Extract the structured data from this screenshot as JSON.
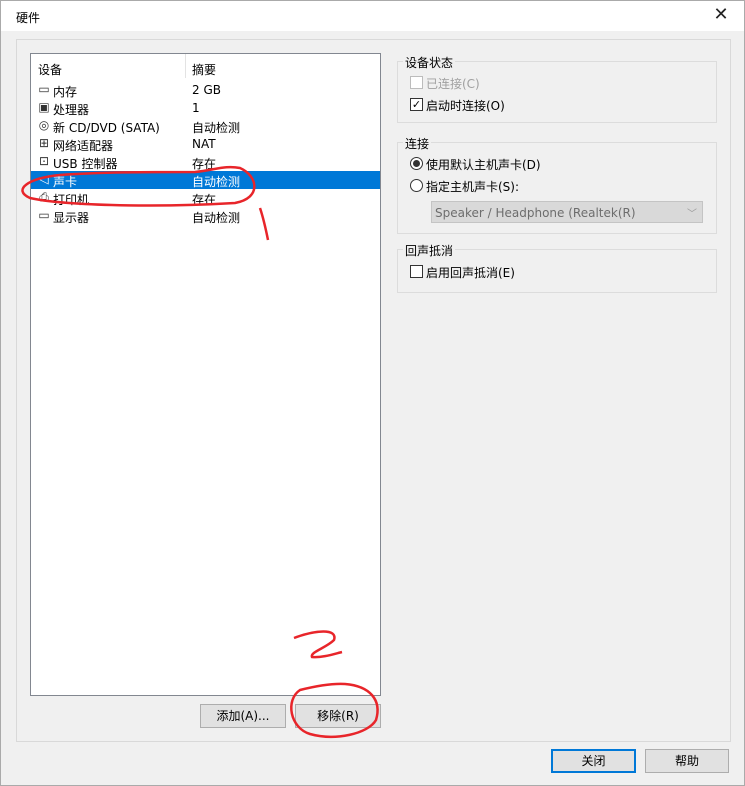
{
  "window": {
    "title": "硬件",
    "close_glyph": "✕"
  },
  "device_list": {
    "col_device": "设备",
    "col_summary": "摘要",
    "rows": [
      {
        "name": "内存",
        "summary": "2 GB",
        "icon": "memory-icon",
        "glyph": "▭"
      },
      {
        "name": "处理器",
        "summary": "1",
        "icon": "cpu-icon",
        "glyph": "▣"
      },
      {
        "name": "新 CD/DVD (SATA)",
        "summary": "自动检测",
        "icon": "cd-icon",
        "glyph": "◎"
      },
      {
        "name": "网络适配器",
        "summary": "NAT",
        "icon": "network-icon",
        "glyph": "⊞"
      },
      {
        "name": "USB 控制器",
        "summary": "存在",
        "icon": "usb-icon",
        "glyph": "⊡"
      },
      {
        "name": "声卡",
        "summary": "自动检测",
        "icon": "speaker-icon",
        "glyph": "◁"
      },
      {
        "name": "打印机",
        "summary": "存在",
        "icon": "printer-icon",
        "glyph": "⎙"
      },
      {
        "name": "显示器",
        "summary": "自动检测",
        "icon": "monitor-icon",
        "glyph": "▭"
      }
    ],
    "selected_index": 5
  },
  "buttons": {
    "add": "添加(A)...",
    "remove": "移除(R)",
    "close": "关闭",
    "help": "帮助"
  },
  "device_status": {
    "label": "设备状态",
    "connected": {
      "text": "已连接(C)",
      "checked": false,
      "disabled": true
    },
    "connect_at_power_on": {
      "text": "启动时连接(O)",
      "checked": true
    }
  },
  "connection": {
    "label": "连接",
    "use_default": {
      "text": "使用默认主机声卡(D)",
      "selected": true
    },
    "specify": {
      "text": "指定主机声卡(S):",
      "selected": false
    },
    "sound_card_select": "Speaker / Headphone (Realtek(R)"
  },
  "echo": {
    "label": "回声抵消",
    "enable": {
      "text": "启用回声抵消(E)",
      "checked": false
    }
  },
  "annotations": {
    "mark_1": "1",
    "mark_2": "2",
    "color": "#e8252a"
  }
}
